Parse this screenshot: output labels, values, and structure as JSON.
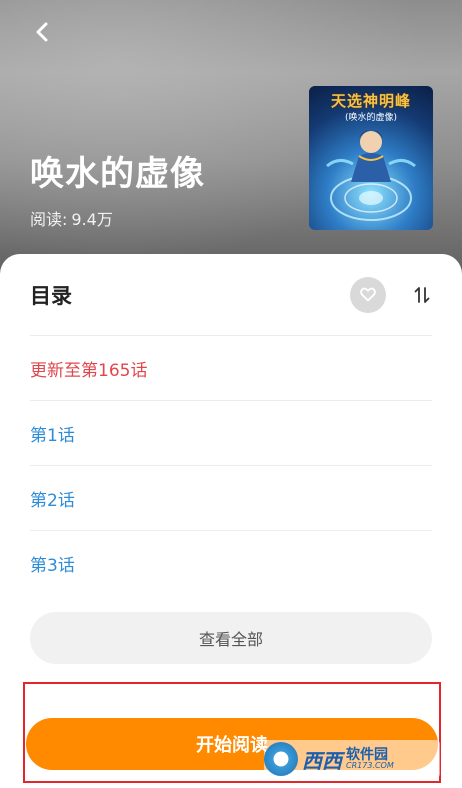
{
  "header": {
    "title": "唤水的虚像",
    "reads_label": "阅读:",
    "reads_value": "9.4万"
  },
  "cover": {
    "title": "天选神明峰",
    "subtitle": "(唤水的虚像)"
  },
  "toc": {
    "title": "目录",
    "chapters": [
      {
        "label": "更新至第165话",
        "type": "latest"
      },
      {
        "label": "第1话",
        "type": "normal"
      },
      {
        "label": "第2话",
        "type": "normal"
      },
      {
        "label": "第3话",
        "type": "normal"
      }
    ],
    "view_all_label": "查看全部"
  },
  "actions": {
    "start_reading_label": "开始阅读"
  },
  "watermark": {
    "brand": "西西",
    "site_name": "软件园",
    "domain": "CR173.COM"
  },
  "icons": {
    "back": "chevron-left-icon",
    "favorite": "heart-icon",
    "sort": "sort-arrows-icon"
  },
  "colors": {
    "accent": "#ff8a00",
    "latest_chapter": "#e0474c",
    "chapter_link": "#2d8cd8",
    "highlight_border": "#e2262b"
  }
}
